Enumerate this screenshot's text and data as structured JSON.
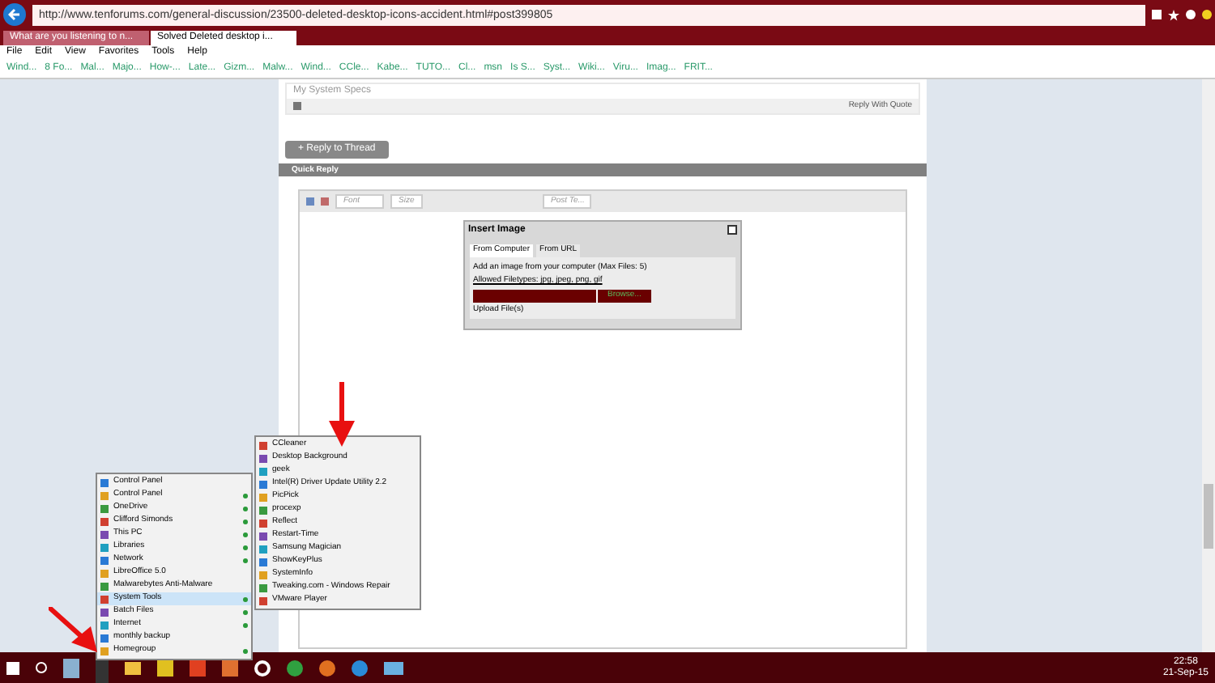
{
  "browser": {
    "address": "http://www.tenforums.com/general-discussion/23500-deleted-desktop-icons-accident.html#post399805",
    "tabs": [
      {
        "label": "What are you listening to n...",
        "selected": false
      },
      {
        "label": "Solved Deleted desktop i...",
        "selected": true
      }
    ],
    "menu": [
      "File",
      "Edit",
      "View",
      "Favorites",
      "Tools",
      "Help"
    ],
    "favorites": [
      "Wind...",
      "8 Fo...",
      "Mal...",
      "Majo...",
      "How-...",
      "Late...",
      "Gizm...",
      "Malw...",
      "Wind...",
      "CCle...",
      "Kabe...",
      "TUTO...",
      "Cl...",
      "msn",
      "Is S...",
      "Syst...",
      "Wiki...",
      "Viru...",
      "Imag...",
      "FRIT..."
    ]
  },
  "post": {
    "specs": "My System Specs",
    "reply_quote": "Reply With Quote"
  },
  "reply_button": "+ Reply to Thread",
  "quick_reply": "Quick Reply",
  "editor": {
    "font": "Font",
    "size": "Size",
    "paste": "Post Te..."
  },
  "dialog": {
    "title": "Insert Image",
    "tabs": [
      {
        "label": "From Computer",
        "selected": true
      },
      {
        "label": "From URL",
        "selected": false
      }
    ],
    "line_1": "Add an image from your computer (Max Files: 5)",
    "line_2": "Allowed Filetypes: jpg, jpeg, png, gif",
    "browse": "Browse...",
    "upload": "Upload File(s)"
  },
  "start_menu": [
    {
      "label": "Control Panel",
      "submenu": false,
      "selected": false
    },
    {
      "label": "Control Panel",
      "submenu": true,
      "selected": false
    },
    {
      "label": "OneDrive",
      "submenu": true,
      "selected": false
    },
    {
      "label": "Clifford Simonds",
      "submenu": true,
      "selected": false
    },
    {
      "label": "This PC",
      "submenu": true,
      "selected": false
    },
    {
      "label": "Libraries",
      "submenu": true,
      "selected": false
    },
    {
      "label": "Network",
      "submenu": true,
      "selected": false
    },
    {
      "label": "LibreOffice 5.0",
      "submenu": false,
      "selected": false
    },
    {
      "label": "Malwarebytes Anti-Malware",
      "submenu": false,
      "selected": false
    },
    {
      "label": "System Tools",
      "submenu": true,
      "selected": true
    },
    {
      "label": "Batch Files",
      "submenu": true,
      "selected": false
    },
    {
      "label": "Internet",
      "submenu": true,
      "selected": false
    },
    {
      "label": "monthly backup",
      "submenu": false,
      "selected": false
    },
    {
      "label": "Homegroup",
      "submenu": true,
      "selected": false
    }
  ],
  "submenu": [
    "CCleaner",
    "Desktop Background",
    "geek",
    "Intel(R) Driver Update Utility 2.2",
    "PicPick",
    "procexp",
    "Reflect",
    "Restart-Time",
    "Samsung Magician",
    "ShowKeyPlus",
    "SystemInfo",
    "Tweaking.com - Windows Repair",
    "VMware Player"
  ],
  "clock": {
    "time": "22:58",
    "date": "21-Sep-15"
  }
}
